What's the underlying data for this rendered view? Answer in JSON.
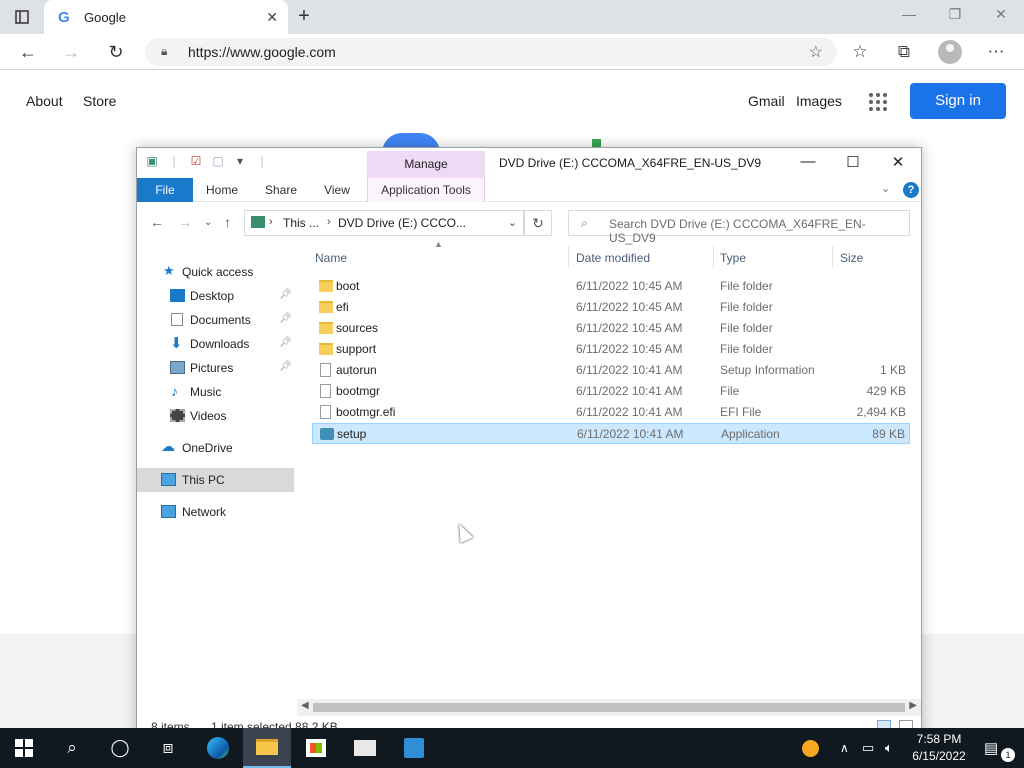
{
  "browser": {
    "tab_title": "Google",
    "tab_favicon": "G",
    "url": "https://www.google.com"
  },
  "google": {
    "about": "About",
    "store": "Store",
    "gmail": "Gmail",
    "images": "Images",
    "sign_in": "Sign in",
    "brand_blue": "#1a73e8"
  },
  "explorer": {
    "manage_tab": "Manage",
    "window_title": "DVD Drive (E:) CCCOMA_X64FRE_EN-US_DV9",
    "ribbon_tabs": [
      "File",
      "Home",
      "Share",
      "View",
      "Application Tools"
    ],
    "breadcrumb": [
      "This ...",
      "DVD Drive (E:) CCCO..."
    ],
    "search_placeholder": "Search DVD Drive (E:) CCCOMA_X64FRE_EN-US_DV9",
    "nav": {
      "quick_access": "Quick access",
      "desktop": "Desktop",
      "documents": "Documents",
      "downloads": "Downloads",
      "pictures": "Pictures",
      "music": "Music",
      "videos": "Videos",
      "onedrive": "OneDrive",
      "this_pc": "This PC",
      "network": "Network"
    },
    "columns": {
      "name": "Name",
      "date_modified": "Date modified",
      "type": "Type",
      "size": "Size"
    },
    "files": [
      {
        "name": "boot",
        "date": "6/11/2022 10:45 AM",
        "type": "File folder",
        "size": ""
      },
      {
        "name": "efi",
        "date": "6/11/2022 10:45 AM",
        "type": "File folder",
        "size": ""
      },
      {
        "name": "sources",
        "date": "6/11/2022 10:45 AM",
        "type": "File folder",
        "size": ""
      },
      {
        "name": "support",
        "date": "6/11/2022 10:45 AM",
        "type": "File folder",
        "size": ""
      },
      {
        "name": "autorun",
        "date": "6/11/2022 10:41 AM",
        "type": "Setup Information",
        "size": "1 KB"
      },
      {
        "name": "bootmgr",
        "date": "6/11/2022 10:41 AM",
        "type": "File",
        "size": "429 KB"
      },
      {
        "name": "bootmgr.efi",
        "date": "6/11/2022 10:41 AM",
        "type": "EFI File",
        "size": "2,494 KB"
      },
      {
        "name": "setup",
        "date": "6/11/2022 10:41 AM",
        "type": "Application",
        "size": "89 KB"
      }
    ],
    "status": {
      "item_count": "8 items",
      "selection": "1 item selected  88.2 KB"
    }
  },
  "taskbar": {
    "time": "7:58 PM",
    "date": "6/15/2022",
    "notification_count": "1"
  }
}
